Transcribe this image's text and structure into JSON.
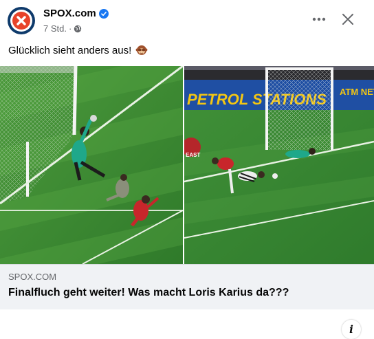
{
  "post": {
    "page_name": "SPOX.com",
    "time": "7 Std.",
    "separator": "·",
    "caption": "Glücklich sieht anders aus!",
    "caption_emoji": "see-no-evil-monkey-emoji"
  },
  "header_actions": {
    "more_icon": "more-horizontal-icon",
    "close_icon": "close-icon"
  },
  "media": {
    "left_image_text": "",
    "right_banner_text": "PETROL STATIONS",
    "right_banner_extra": "ATM NETW",
    "badge_text": "EAST"
  },
  "link_preview": {
    "domain": "SPOX.COM",
    "title": "Finalfluch geht weiter! Was macht Loris Karius da???"
  },
  "colors": {
    "brand": "#e8432a",
    "verified": "#1877f2",
    "pitch": "#3f8a34",
    "footer_bg": "#f0f2f5"
  }
}
